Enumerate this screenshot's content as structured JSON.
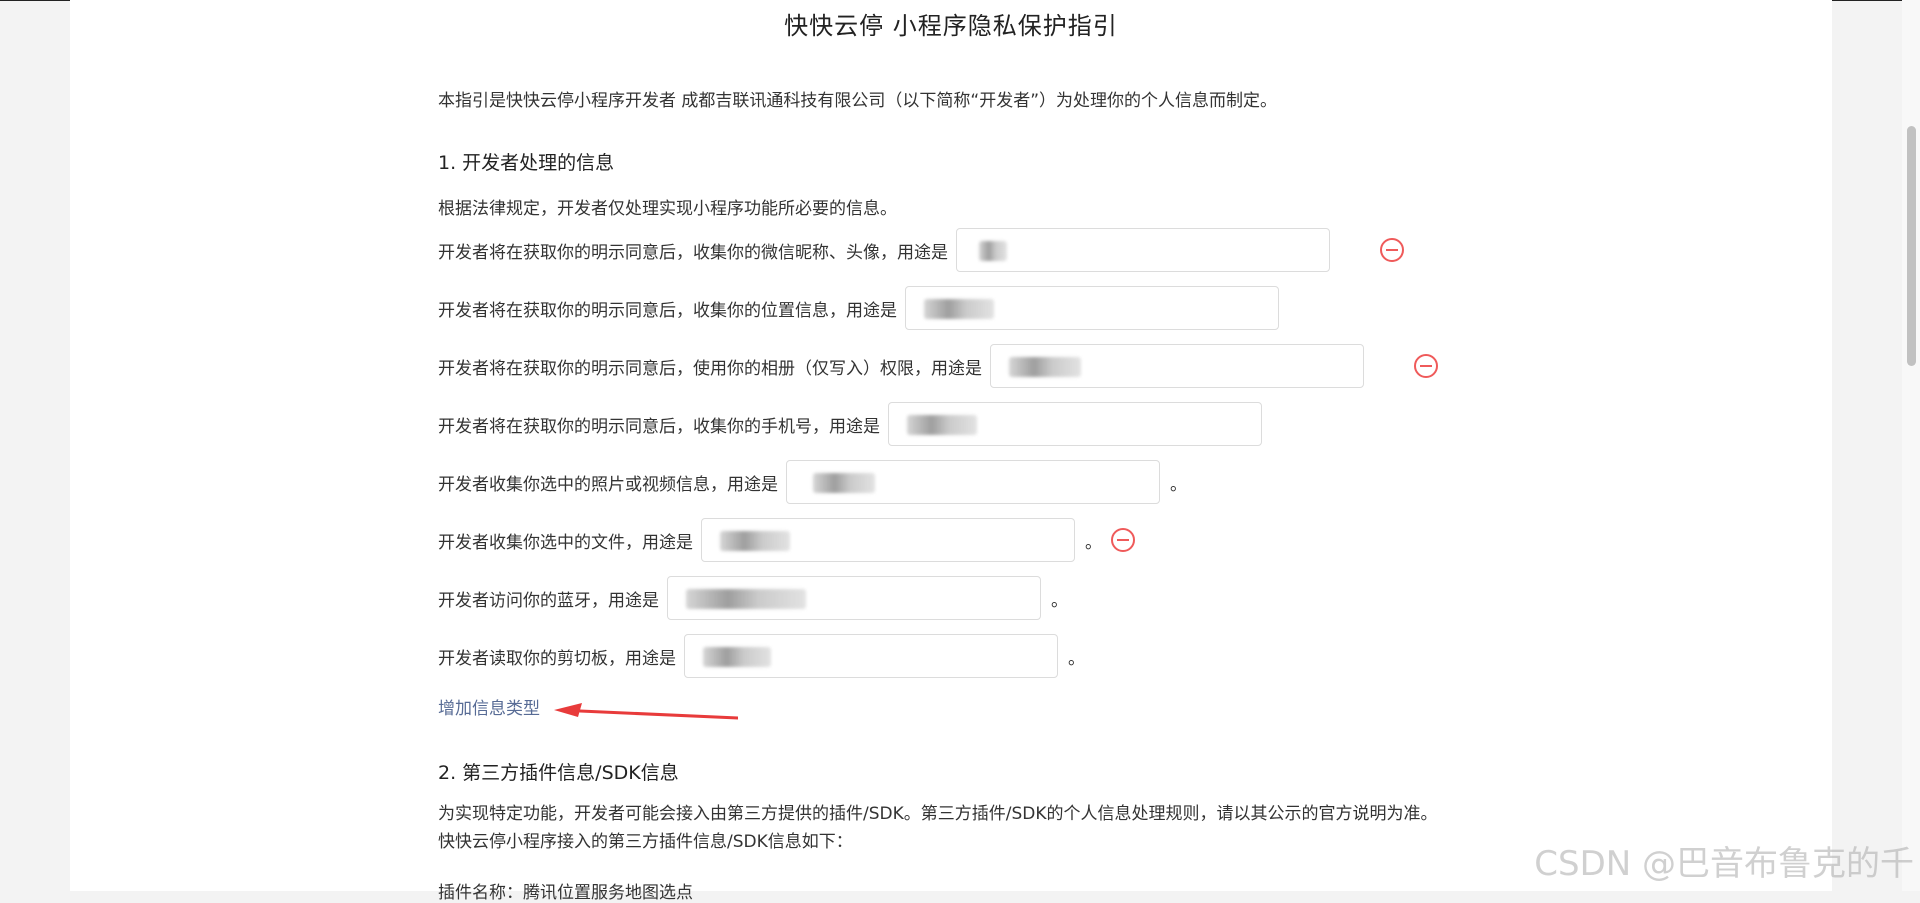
{
  "page": {
    "title": "快快云停 小程序隐私保护指引",
    "intro": "本指引是快快云停小程序开发者 成都吉联讯通科技有限公司（以下简称“开发者”）为处理你的个人信息而制定。"
  },
  "section1": {
    "title": "1.  开发者处理的信息",
    "desc": "根据法律规定，开发者仅处理实现小程序功能所必要的信息。",
    "rows": [
      {
        "label": "开发者将在获取你的明示同意后，收集你的微信昵称、头像，用途是",
        "trail": "",
        "removable": true
      },
      {
        "label": "开发者将在获取你的明示同意后，收集你的位置信息，用途是",
        "trail": "",
        "removable": false
      },
      {
        "label": "开发者将在获取你的明示同意后，使用你的相册（仅写入）权限，用途是",
        "trail": "",
        "removable": true
      },
      {
        "label": "开发者将在获取你的明示同意后，收集你的手机号，用途是",
        "trail": "",
        "removable": false
      },
      {
        "label": "开发者收集你选中的照片或视频信息，用途是",
        "trail": "。",
        "removable": false
      },
      {
        "label": "开发者收集你选中的文件，用途是",
        "trail": "。",
        "removable": true
      },
      {
        "label": "开发者访问你的蓝牙，用途是",
        "trail": "。",
        "removable": false
      },
      {
        "label": "开发者读取你的剪切板，用途是",
        "trail": "。",
        "removable": false
      }
    ],
    "add_link": "增加信息类型"
  },
  "section2": {
    "title": "2.  第三方插件信息/SDK信息",
    "desc": "为实现特定功能，开发者可能会接入由第三方提供的插件/SDK。第三方插件/SDK的个人信息处理规则，请以其公示的官方说明为准。快快云停小程序接入的第三方插件信息/SDK信息如下：",
    "cut_line": "插件名称：腾讯位置服务地图选点"
  },
  "watermark": "CSDN @巴音布鲁克的千",
  "colors": {
    "link": "#576b95",
    "remove": "#ef5a5a",
    "annotation_arrow": "#e83b3b"
  }
}
